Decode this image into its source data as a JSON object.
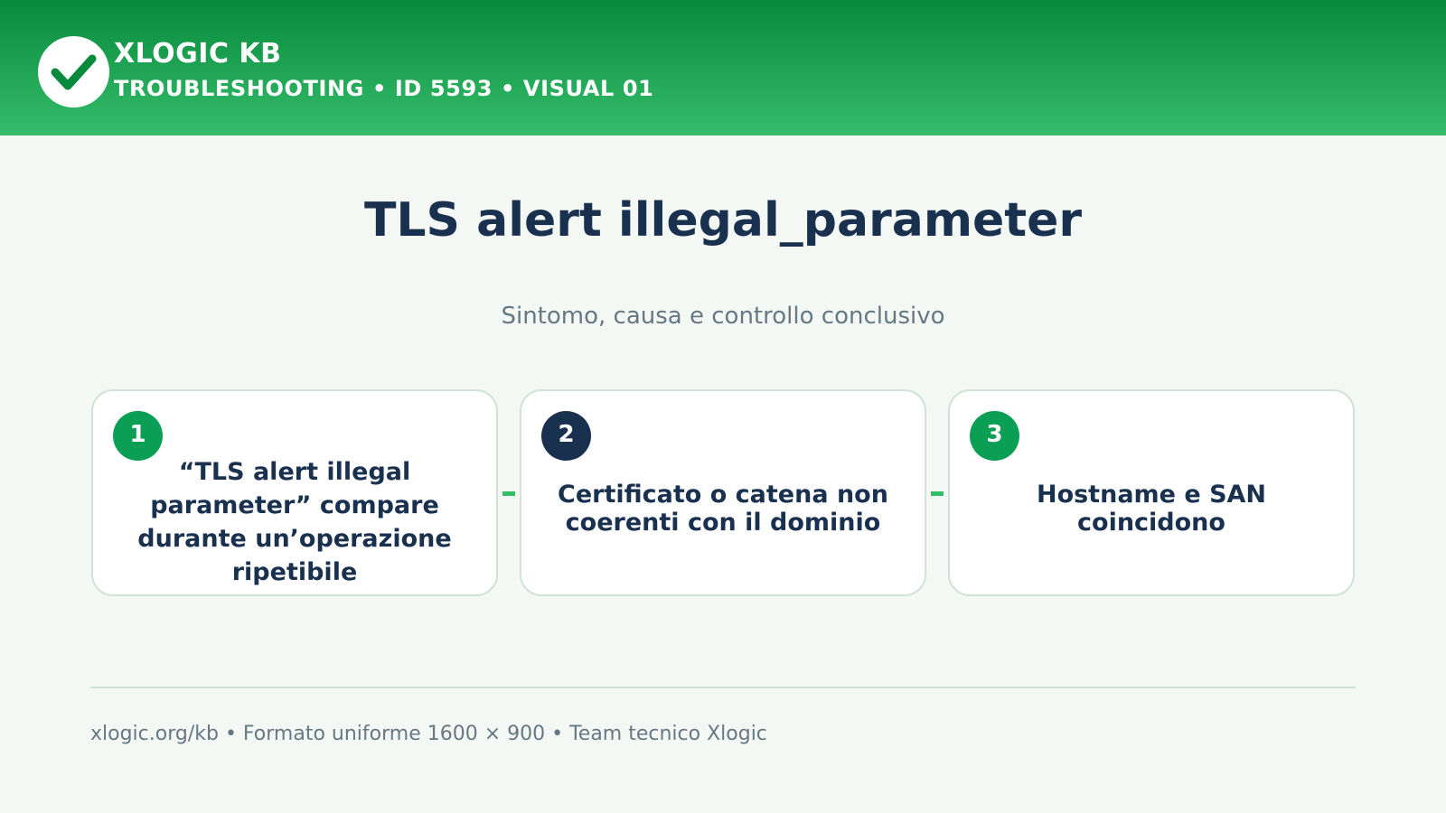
{
  "header": {
    "brand": "XLOGIC KB",
    "subtitle": "TROUBLESHOOTING • ID 5593 • VISUAL 01",
    "logo_icon": "checkmark-icon",
    "gradient_top": "#078a3c",
    "gradient_bottom": "#35bd6a"
  },
  "main": {
    "title": "TLS alert illegal_parameter",
    "subtitle": "Sintomo, causa e controllo conclusivo"
  },
  "steps": [
    {
      "number": "1",
      "text": "“TLS alert illegal parameter” compare durante un’operazione ripetibile",
      "badge_color": "#0b9f55"
    },
    {
      "number": "2",
      "text": "Certificato o catena non coerenti con il dominio",
      "badge_color": "#19304f"
    },
    {
      "number": "3",
      "text": "Hostname e SAN coincidono",
      "badge_color": "#0b9f55"
    }
  ],
  "footer": {
    "text": "xlogic.org/kb • Formato uniforme 1600 × 900 • Team tecnico Xlogic"
  },
  "colors": {
    "accent": "#35bd6a",
    "navy": "#19304f",
    "background": "#f3f8f5"
  }
}
